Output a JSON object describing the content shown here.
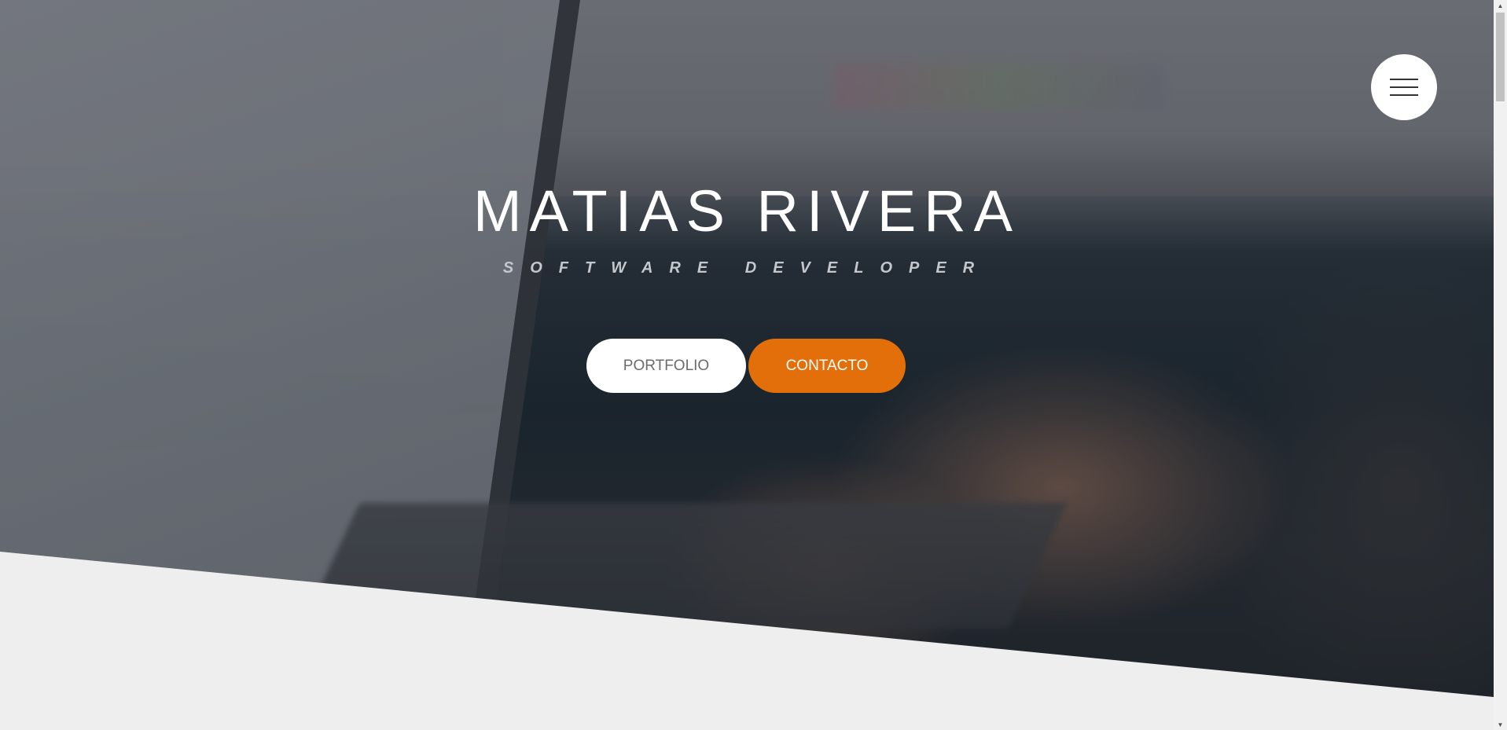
{
  "hero": {
    "title": "MATIAS RIVERA",
    "subtitle": "SOFTWARE DEVELOPER",
    "background_image": "laptop-typing-photo",
    "overlay_color": "#141a22"
  },
  "menu": {
    "icon": "hamburger-icon"
  },
  "buttons": {
    "portfolio_label": "PORTFOLIO",
    "contacto_label": "CONTACTO"
  },
  "colors": {
    "accent": "#e36f0a",
    "button_light": "#ffffff",
    "section_bg": "#eeeeee"
  },
  "scrollbar": {
    "up_icon": "arrow-up-icon",
    "down_icon": "arrow-down-icon"
  }
}
